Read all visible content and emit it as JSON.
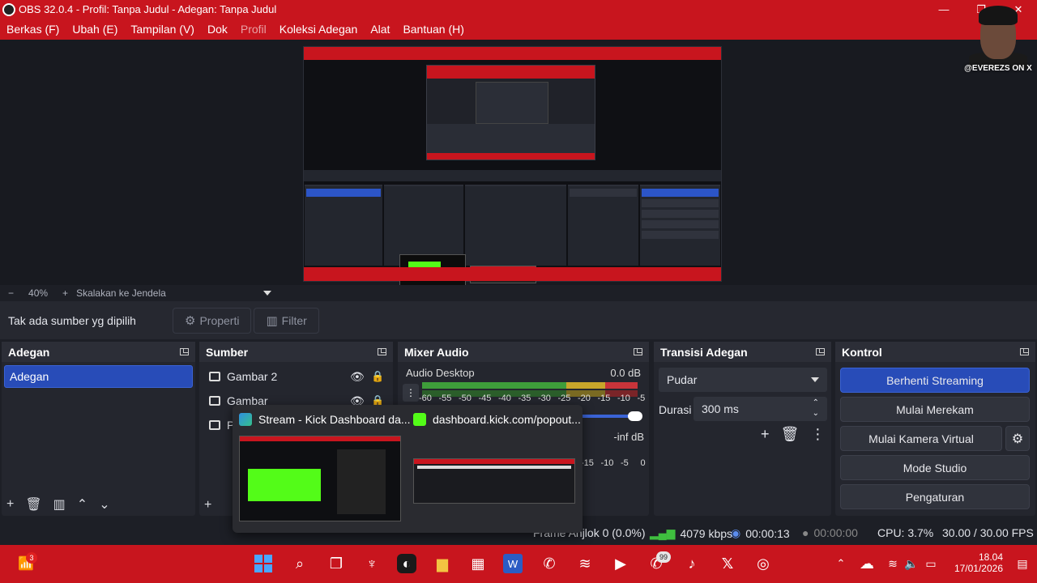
{
  "window": {
    "title": "OBS 32.0.4 - Profil: Tanpa Judul - Adegan: Tanpa Judul",
    "minimize": "—",
    "restore": "❐",
    "close": "✕"
  },
  "menu": [
    "Berkas (F)",
    "Ubah (E)",
    "Tampilan (V)",
    "Dok",
    "Profil",
    "Koleksi Adegan",
    "Alat",
    "Bantuan (H)"
  ],
  "overlay": {
    "handle": "@EVEREZS ON X"
  },
  "zoom": {
    "minus": "−",
    "value": "40%",
    "plus": "+",
    "mode": "Skalakan ke Jendela"
  },
  "source_bar": {
    "label": "Tak ada sumber yg dipilih",
    "properties": "Properti",
    "filters": "Filter"
  },
  "scenes": {
    "title": "Adegan",
    "items": [
      "Adegan"
    ]
  },
  "sources": {
    "title": "Sumber",
    "items": [
      "Gambar 2",
      "Gambar",
      "P"
    ]
  },
  "mixer": {
    "title": "Mixer Audio",
    "channel1": {
      "name": "Audio Desktop",
      "level": "0.0 dB"
    },
    "channel2": {
      "level": "-inf dB"
    },
    "scale": [
      "-60",
      "-55",
      "-50",
      "-45",
      "-40",
      "-35",
      "-30",
      "-25",
      "-20",
      "-15",
      "-10",
      "-5",
      "0"
    ],
    "scale2": [
      "-15",
      "-10",
      "-5",
      "0"
    ]
  },
  "transitions": {
    "title": "Transisi Adegan",
    "selected": "Pudar",
    "duration_label": "Durasi",
    "duration": "300 ms"
  },
  "controls": {
    "title": "Kontrol",
    "stop_streaming": "Berhenti Streaming",
    "start_recording": "Mulai Merekam",
    "virtual_camera": "Mulai Kamera Virtual",
    "studio_mode": "Mode Studio",
    "settings": "Pengaturan"
  },
  "status": {
    "dropped": "Frame Anjlok 0 (0.0%)",
    "bitrate": "4079 kbps",
    "stream_time": "00:00:13",
    "rec_time": "00:00:00",
    "cpu": "CPU: 3.7%",
    "fps": "30.00 / 30.00 FPS"
  },
  "taskbar_popup": {
    "window1": "Stream - Kick Dashboard da...",
    "window2": "dashboard.kick.com/popout..."
  },
  "taskbar": {
    "widget_badge": "3",
    "whatsapp_badge": "99",
    "time": "18.04",
    "date": "17/01/2026"
  },
  "colors": {
    "accent_red": "#c8151e",
    "selection_blue": "#284cb8",
    "kick_green": "#53fc18"
  },
  "icons": [
    "search-icon",
    "task-view-icon",
    "edge-icon",
    "folder-icon",
    "store-icon",
    "word-icon",
    "whatsapp-icon",
    "spotify-icon",
    "youtube-icon",
    "tiktok-icon",
    "x-icon",
    "obs-icon",
    "wifi-icon",
    "volume-icon",
    "battery-icon"
  ]
}
